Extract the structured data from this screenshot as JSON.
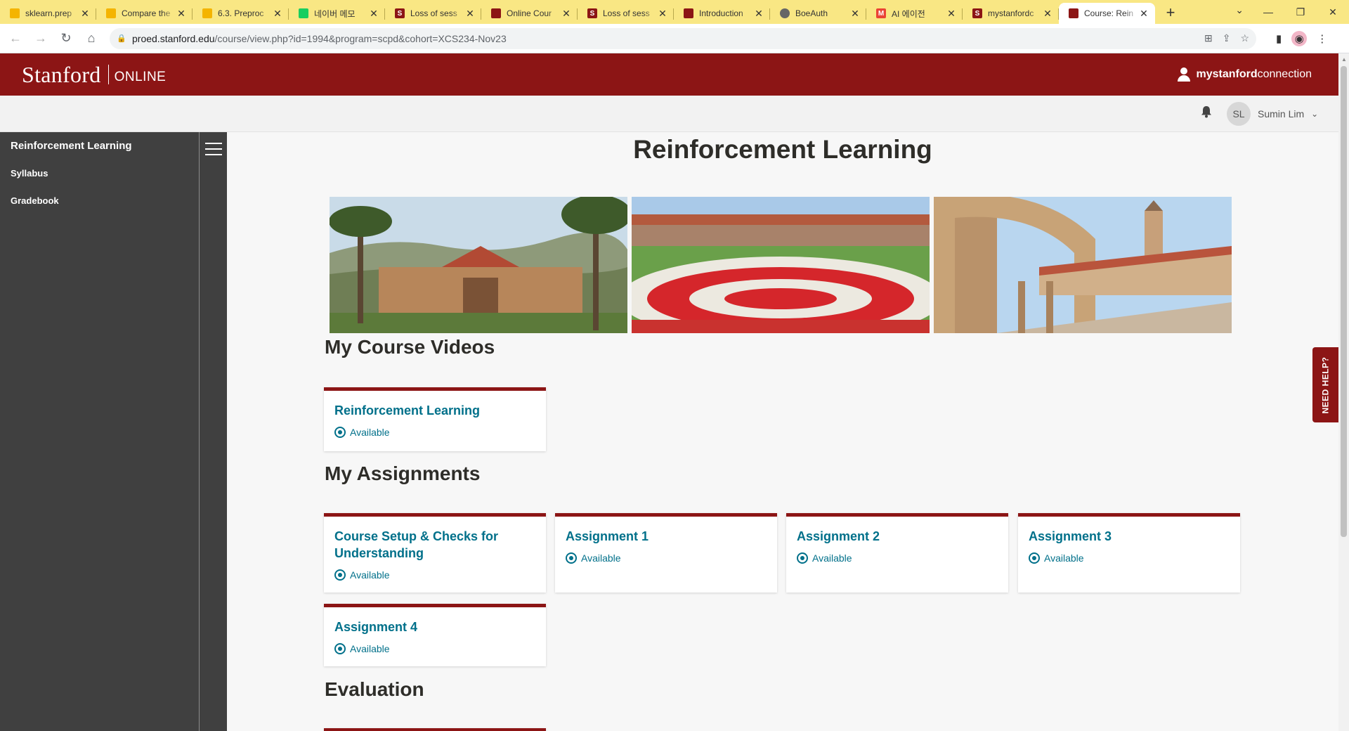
{
  "browser": {
    "tabs": [
      {
        "title": "sklearn.prep",
        "color": "#f4b400",
        "glyph": ""
      },
      {
        "title": "Compare the",
        "color": "#f4b400",
        "glyph": ""
      },
      {
        "title": "6.3. Preproc",
        "color": "#f4b400",
        "glyph": ""
      },
      {
        "title": "네이버 메모",
        "color": "#19ce60",
        "glyph": ""
      },
      {
        "title": "Loss of sess",
        "color": "#8c1515",
        "glyph": "S"
      },
      {
        "title": "Online Cour",
        "color": "#8c1515",
        "glyph": ""
      },
      {
        "title": "Loss of sess",
        "color": "#8c1515",
        "glyph": "S"
      },
      {
        "title": "Introduction",
        "color": "#8c1515",
        "glyph": ""
      },
      {
        "title": "BoeAuth",
        "color": "#666666",
        "glyph": ""
      },
      {
        "title": "AI 에이전",
        "color": "#ea4335",
        "glyph": "M"
      },
      {
        "title": "mystanfordc",
        "color": "#8c1515",
        "glyph": "S"
      },
      {
        "title": "Course: Rein",
        "color": "#8c1515",
        "glyph": ""
      }
    ],
    "new_tab": "+",
    "url_host": "proed.stanford.edu",
    "url_path": "/course/view.php?id=1994&program=scpd&cohort=XCS234-Nov23"
  },
  "header": {
    "brand": "Stanford",
    "sub": "ONLINE",
    "conn_bold": "mystanford",
    "conn_rest": "connection"
  },
  "userbar": {
    "initials": "SL",
    "name": "Sumin Lim"
  },
  "sidebar": {
    "title": "Reinforcement Learning",
    "items": [
      "Syllabus",
      "Gradebook"
    ]
  },
  "main": {
    "title": "Reinforcement Learning",
    "sections": {
      "videos": "My Course Videos",
      "assignments": "My Assignments",
      "evaluation": "Evaluation"
    },
    "videos": [
      {
        "title": "Reinforcement Learning",
        "status": "Available"
      }
    ],
    "assignments": [
      {
        "title": "Course Setup & Checks for Understanding",
        "status": "Available"
      },
      {
        "title": "Assignment 1",
        "status": "Available"
      },
      {
        "title": "Assignment 2",
        "status": "Available"
      },
      {
        "title": "Assignment 3",
        "status": "Available"
      },
      {
        "title": "Assignment 4",
        "status": "Available"
      }
    ]
  },
  "need_help": "NEED HELP?",
  "colors": {
    "cardinal": "#8c1515",
    "link": "#00708a",
    "sidebar": "#404040"
  }
}
